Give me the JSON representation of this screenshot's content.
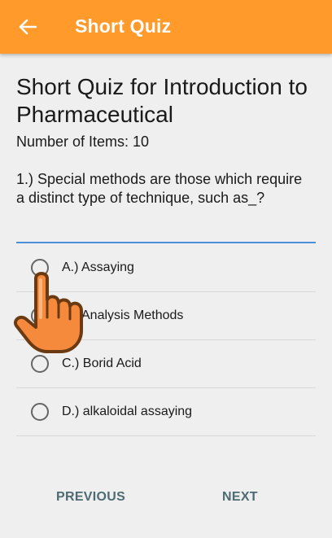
{
  "appbar": {
    "title": "Short Quiz",
    "back_icon": "arrow-left-icon",
    "color": "#ff9a2b"
  },
  "quiz": {
    "title": "Short Quiz for Introduction to Pharmaceutical",
    "item_count": "Number of Items: 10",
    "question": "1.) Special methods are those which require a distinct type of technique, such as_?"
  },
  "options": [
    {
      "label": "A.) Assaying",
      "selected": false
    },
    {
      "label": "B.) Analysis Methods",
      "selected": false
    },
    {
      "label": "C.) Borid Acid",
      "selected": false
    },
    {
      "label": "D.) alkaloidal assaying",
      "selected": false
    }
  ],
  "nav": {
    "previous": "PREVIOUS",
    "next": "NEXT"
  },
  "overlay": {
    "icon": "pointing-hand-icon",
    "color": "#f58a3c"
  }
}
